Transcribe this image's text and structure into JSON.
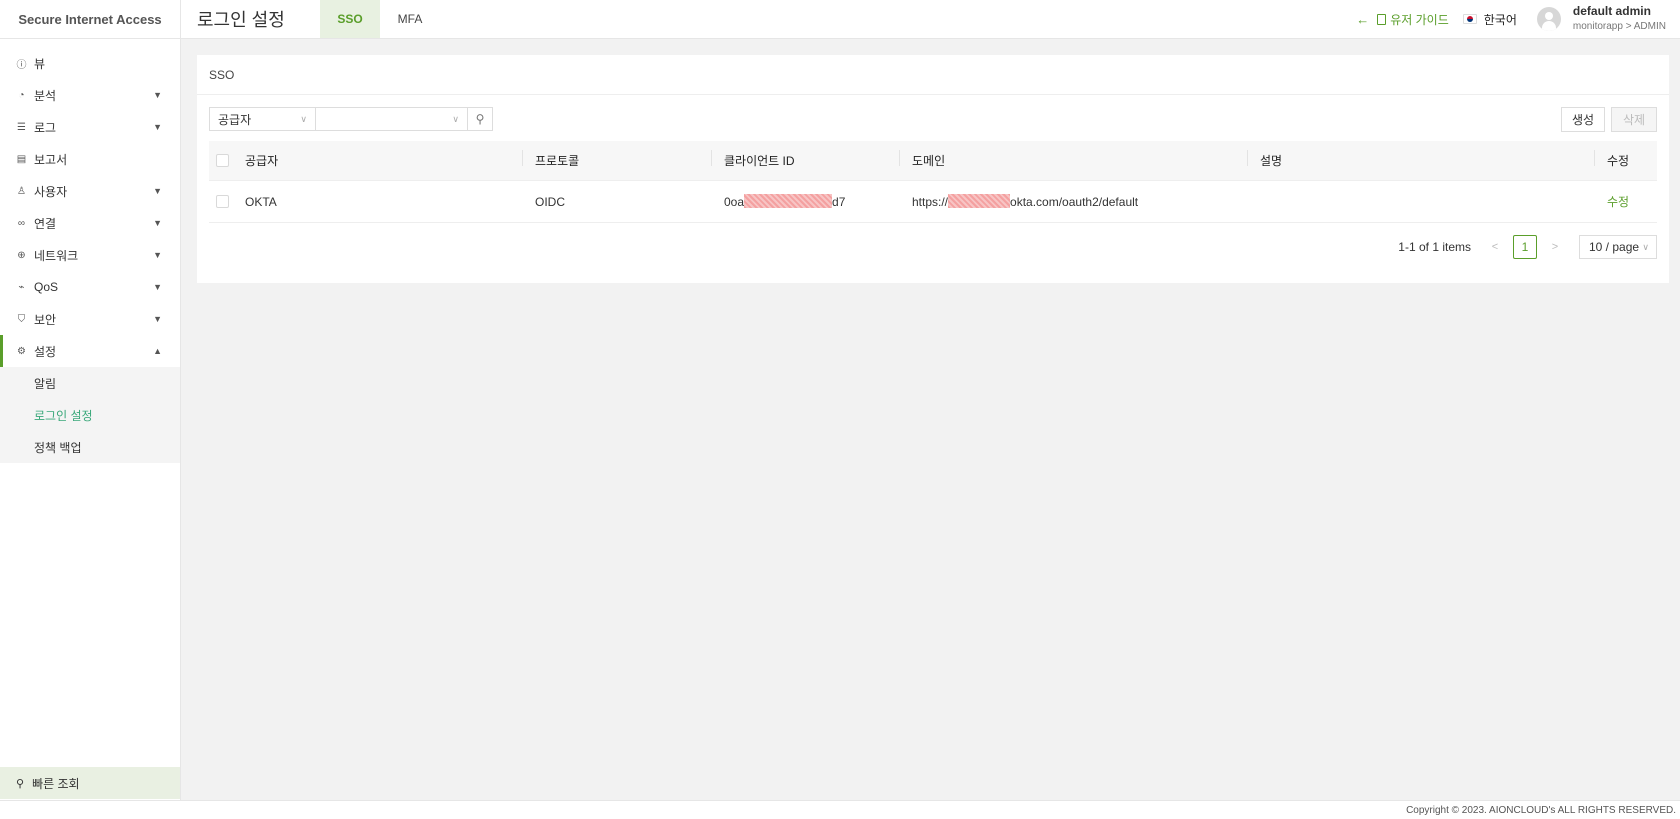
{
  "brand": "Secure Internet Access",
  "page_title": "로그인 설정",
  "tabs": [
    {
      "label": "SSO",
      "active": true
    },
    {
      "label": "MFA",
      "active": false
    }
  ],
  "header": {
    "user_guide": "유저 가이드",
    "language": "한국어",
    "user_name": "default admin",
    "user_role": "monitorapp > ADMIN"
  },
  "sidebar": {
    "items": [
      {
        "label": "뷰",
        "icon": "info-icon"
      },
      {
        "label": "분석",
        "icon": "chart-icon"
      },
      {
        "label": "로그",
        "icon": "list-icon"
      },
      {
        "label": "보고서",
        "icon": "report-icon"
      },
      {
        "label": "사용자",
        "icon": "user-icon"
      },
      {
        "label": "연결",
        "icon": "link-icon"
      },
      {
        "label": "네트워크",
        "icon": "globe-icon"
      },
      {
        "label": "QoS",
        "icon": "qos-icon"
      },
      {
        "label": "보안",
        "icon": "shield-icon"
      },
      {
        "label": "설정",
        "icon": "gear-icon"
      }
    ],
    "submenu": [
      {
        "label": "알림"
      },
      {
        "label": "로그인 설정"
      },
      {
        "label": "정책 백업"
      }
    ],
    "quick_search": "빠른 조회"
  },
  "card": {
    "title": "SSO",
    "filter_select": "공급자",
    "filter_value": "",
    "create_button": "생성",
    "delete_button": "삭제",
    "columns": [
      "공급자",
      "프로토콜",
      "클라이언트 ID",
      "도메인",
      "설명",
      "수정"
    ],
    "rows": [
      {
        "provider": "OKTA",
        "protocol": "OIDC",
        "client_id_prefix": "0oa",
        "client_id_suffix": "d7",
        "domain_prefix": "https://",
        "domain_suffix": "okta.com/oauth2/default",
        "description": "",
        "edit": "수정"
      }
    ],
    "pagination": {
      "summary": "1-1 of 1 items",
      "current_page": "1",
      "page_size": "10 / page"
    }
  },
  "footer": "Copyright © 2023. AIONCLOUD's ALL RIGHTS RESERVED."
}
